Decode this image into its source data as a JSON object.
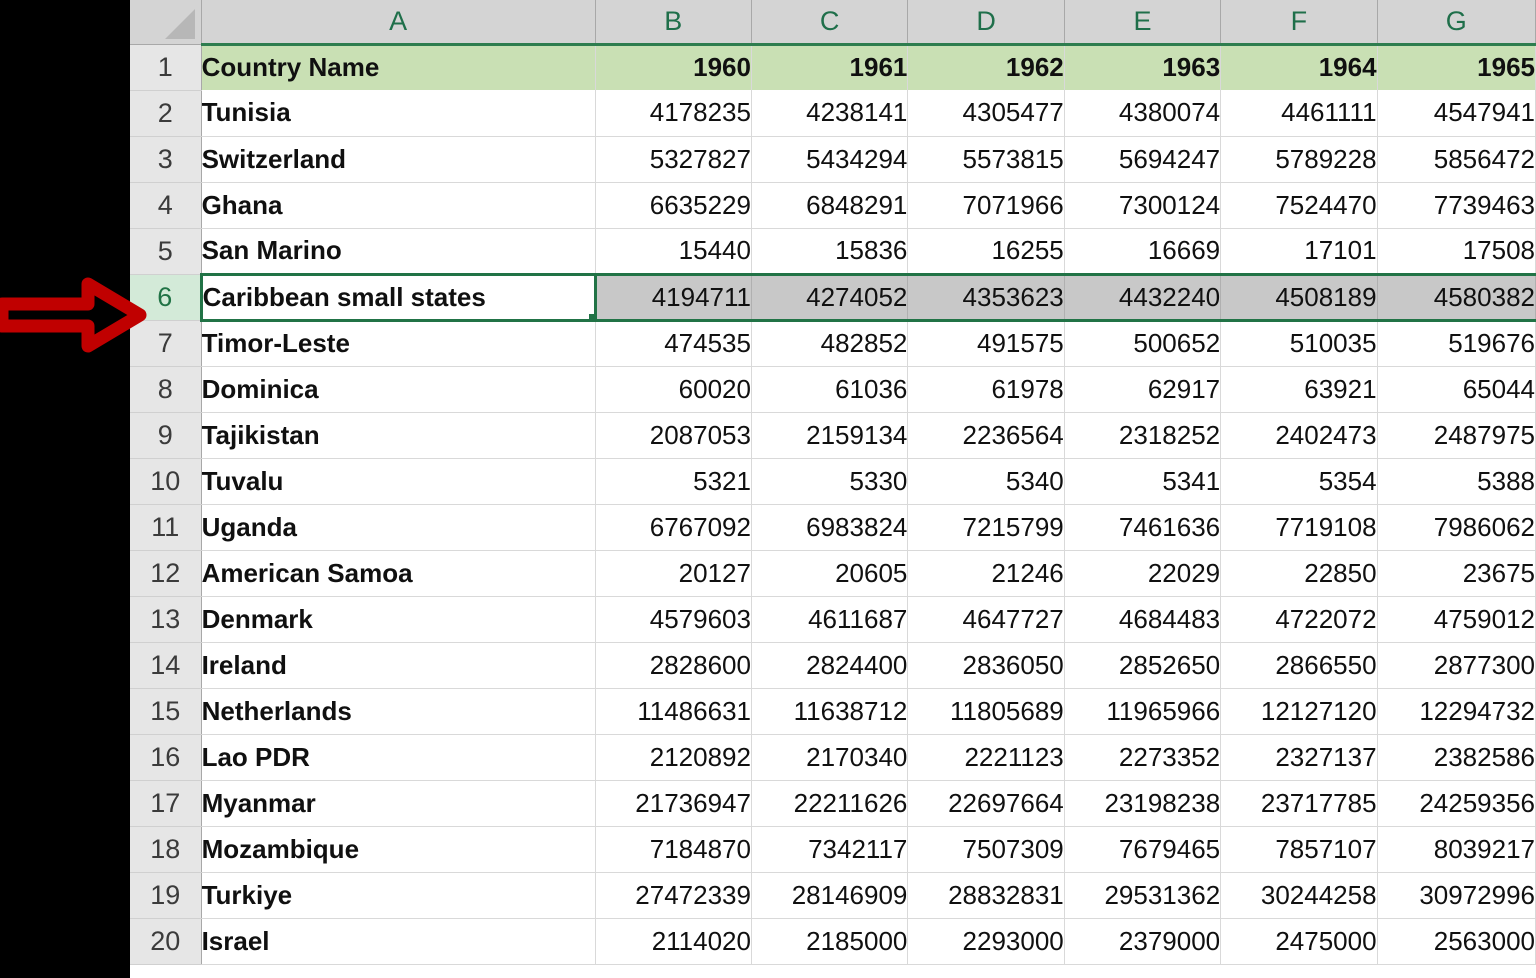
{
  "app": {
    "type": "spreadsheet",
    "select_all_icon": "select-all-triangle-icon"
  },
  "annotation": {
    "arrow_icon": "red-right-arrow-icon",
    "arrow_color": "#c00000",
    "points_at_row": "6"
  },
  "selection": {
    "active_cell": "A6",
    "active_row": "6",
    "selected_range": "A6:G6",
    "highlight_color": "#217346",
    "range_fill": "#c8c8c8"
  },
  "colors": {
    "header_fill": "#c9e0b4",
    "header_border": "#2e7d4f",
    "col_header_fill": "#d4d4d4",
    "row_header_fill": "#e6e6e6",
    "active_row_header_fill": "#d3ead8",
    "grid_line": "#d9d9d9"
  },
  "grid": {
    "column_letters": [
      "A",
      "B",
      "C",
      "D",
      "E",
      "F",
      "G"
    ],
    "row_numbers": [
      "1",
      "2",
      "3",
      "4",
      "5",
      "6",
      "7",
      "8",
      "9",
      "10",
      "11",
      "12",
      "13",
      "14",
      "15",
      "16",
      "17",
      "18",
      "19",
      "20"
    ]
  },
  "sheet": {
    "headers": [
      "Country Name",
      "1960",
      "1961",
      "1962",
      "1963",
      "1964",
      "1965"
    ],
    "rows": [
      {
        "row": "2",
        "cells": [
          "Tunisia",
          "4178235",
          "4238141",
          "4305477",
          "4380074",
          "4461111",
          "4547941"
        ]
      },
      {
        "row": "3",
        "cells": [
          "Switzerland",
          "5327827",
          "5434294",
          "5573815",
          "5694247",
          "5789228",
          "5856472"
        ]
      },
      {
        "row": "4",
        "cells": [
          "Ghana",
          "6635229",
          "6848291",
          "7071966",
          "7300124",
          "7524470",
          "7739463"
        ]
      },
      {
        "row": "5",
        "cells": [
          "San Marino",
          "15440",
          "15836",
          "16255",
          "16669",
          "17101",
          "17508"
        ]
      },
      {
        "row": "6",
        "cells": [
          "Caribbean small states",
          "4194711",
          "4274052",
          "4353623",
          "4432240",
          "4508189",
          "4580382"
        ]
      },
      {
        "row": "7",
        "cells": [
          "Timor-Leste",
          "474535",
          "482852",
          "491575",
          "500652",
          "510035",
          "519676"
        ]
      },
      {
        "row": "8",
        "cells": [
          "Dominica",
          "60020",
          "61036",
          "61978",
          "62917",
          "63921",
          "65044"
        ]
      },
      {
        "row": "9",
        "cells": [
          "Tajikistan",
          "2087053",
          "2159134",
          "2236564",
          "2318252",
          "2402473",
          "2487975"
        ]
      },
      {
        "row": "10",
        "cells": [
          "Tuvalu",
          "5321",
          "5330",
          "5340",
          "5341",
          "5354",
          "5388"
        ]
      },
      {
        "row": "11",
        "cells": [
          "Uganda",
          "6767092",
          "6983824",
          "7215799",
          "7461636",
          "7719108",
          "7986062"
        ]
      },
      {
        "row": "12",
        "cells": [
          "American Samoa",
          "20127",
          "20605",
          "21246",
          "22029",
          "22850",
          "23675"
        ]
      },
      {
        "row": "13",
        "cells": [
          "Denmark",
          "4579603",
          "4611687",
          "4647727",
          "4684483",
          "4722072",
          "4759012"
        ]
      },
      {
        "row": "14",
        "cells": [
          "Ireland",
          "2828600",
          "2824400",
          "2836050",
          "2852650",
          "2866550",
          "2877300"
        ]
      },
      {
        "row": "15",
        "cells": [
          "Netherlands",
          "11486631",
          "11638712",
          "11805689",
          "11965966",
          "12127120",
          "12294732"
        ]
      },
      {
        "row": "16",
        "cells": [
          "Lao PDR",
          "2120892",
          "2170340",
          "2221123",
          "2273352",
          "2327137",
          "2382586"
        ]
      },
      {
        "row": "17",
        "cells": [
          "Myanmar",
          "21736947",
          "22211626",
          "22697664",
          "23198238",
          "23717785",
          "24259356"
        ]
      },
      {
        "row": "18",
        "cells": [
          "Mozambique",
          "7184870",
          "7342117",
          "7507309",
          "7679465",
          "7857107",
          "8039217"
        ]
      },
      {
        "row": "19",
        "cells": [
          "Turkiye",
          "27472339",
          "28146909",
          "28832831",
          "29531362",
          "30244258",
          "30972996"
        ]
      },
      {
        "row": "20",
        "cells": [
          "Israel",
          "2114020",
          "2185000",
          "2293000",
          "2379000",
          "2475000",
          "2563000"
        ]
      }
    ]
  }
}
